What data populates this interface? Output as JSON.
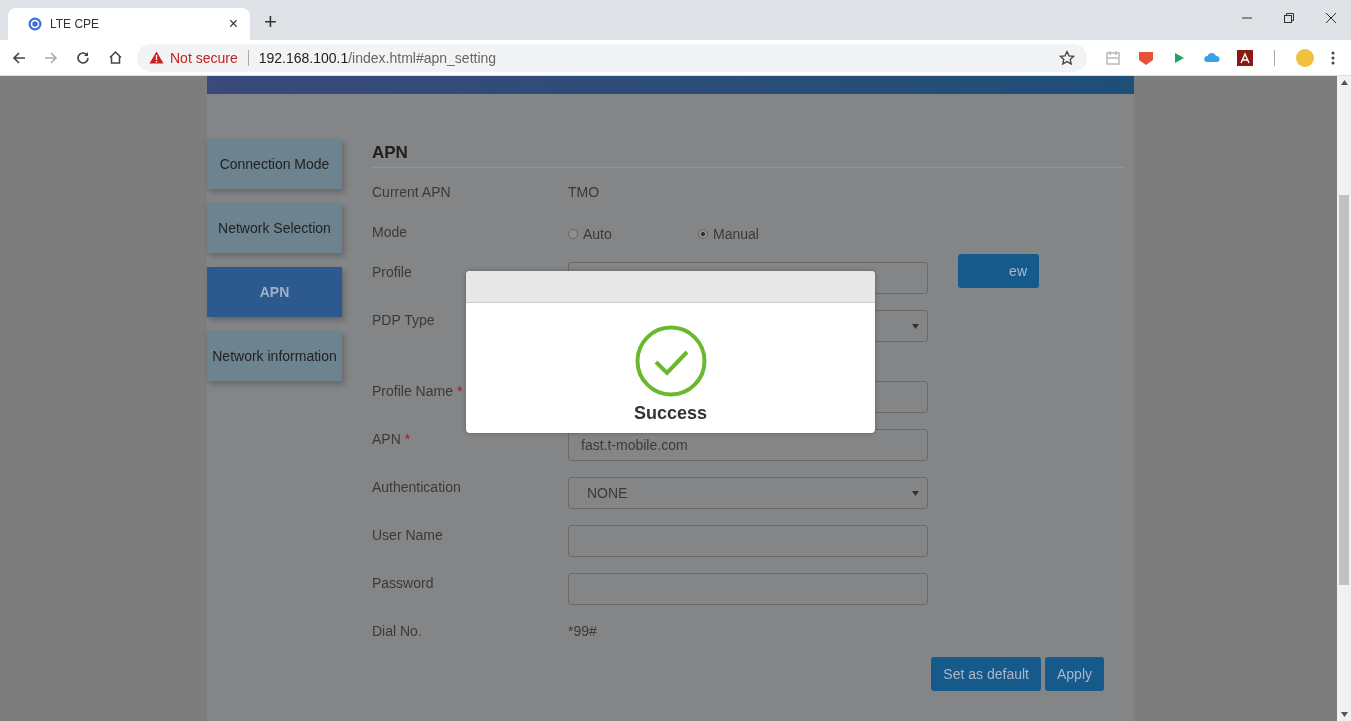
{
  "browser": {
    "tab_title": "LTE CPE",
    "close_tab": "×",
    "new_tab": "+",
    "security": "Not secure",
    "url_host": "192.168.100.1",
    "url_path": "/index.html#apn_setting"
  },
  "sidebar": {
    "items": [
      {
        "label": "Connection Mode",
        "selected": false
      },
      {
        "label": "Network Selection",
        "selected": false
      },
      {
        "label": "APN",
        "selected": true
      },
      {
        "label": "Network information",
        "selected": false
      }
    ]
  },
  "section_title": "APN",
  "fields": [
    {
      "kind": "text",
      "label": "Current APN",
      "value": "TMO"
    },
    {
      "kind": "radio",
      "label": "Mode",
      "options": [
        {
          "label": "Auto",
          "selected": false
        },
        {
          "label": "Manual",
          "selected": true
        }
      ]
    },
    {
      "kind": "profile",
      "label": "Profile",
      "button": "ew"
    },
    {
      "kind": "select",
      "label": "PDP Type"
    },
    {
      "kind": "input",
      "label": "Profile Name",
      "required": true
    },
    {
      "kind": "input",
      "label": "APN",
      "required": true,
      "value": "fast.t-mobile.com"
    },
    {
      "kind": "select",
      "label": "Authentication",
      "value": "NONE"
    },
    {
      "kind": "input",
      "label": "User Name"
    },
    {
      "kind": "input",
      "label": "Password"
    },
    {
      "kind": "text",
      "label": "Dial No.",
      "value": "*99#"
    }
  ],
  "required_mark": "*",
  "buttons": [
    "Set as default",
    "Apply"
  ],
  "dialog": {
    "message": "Success"
  }
}
